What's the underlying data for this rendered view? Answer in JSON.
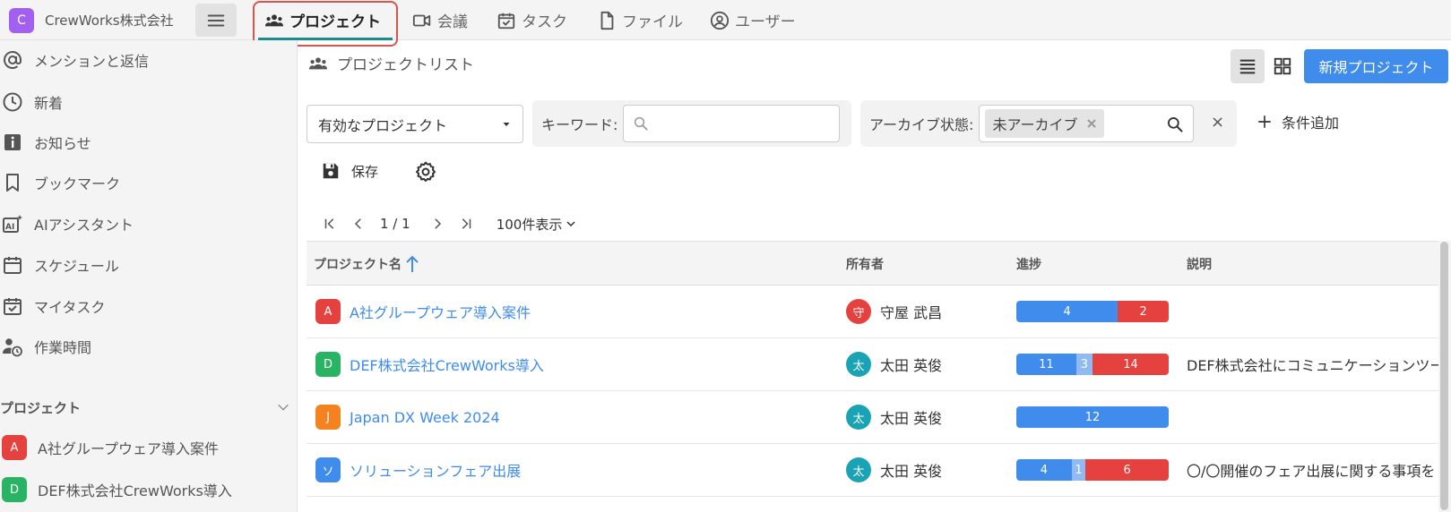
{
  "org": {
    "initial": "C",
    "name": "CrewWorks株式会社",
    "color": "#a25ff0"
  },
  "nav": {
    "tabs": [
      {
        "label": "プロジェクト",
        "icon": "people-icon",
        "active": true
      },
      {
        "label": "会議",
        "icon": "video-icon"
      },
      {
        "label": "タスク",
        "icon": "task-check-icon"
      },
      {
        "label": "ファイル",
        "icon": "file-icon"
      },
      {
        "label": "ユーザー",
        "icon": "user-circle-icon"
      }
    ]
  },
  "sidebar": {
    "items": [
      {
        "label": "メンションと返信",
        "icon": "at-icon"
      },
      {
        "label": "新着",
        "icon": "clock-icon"
      },
      {
        "label": "お知らせ",
        "icon": "info-icon"
      },
      {
        "label": "ブックマーク",
        "icon": "bookmark-icon"
      },
      {
        "label": "AIアシスタント",
        "icon": "ai-icon"
      },
      {
        "label": "スケジュール",
        "icon": "calendar-icon"
      },
      {
        "label": "マイタスク",
        "icon": "task-check-icon"
      },
      {
        "label": "作業時間",
        "icon": "user-clock-icon"
      }
    ],
    "section_title": "プロジェクト",
    "projects": [
      {
        "initial": "A",
        "label": "A社グループウェア導入案件",
        "color": "#e5413f"
      },
      {
        "initial": "D",
        "label": "DEF株式会社CrewWorks導入",
        "color": "#28b463"
      }
    ]
  },
  "main": {
    "title": "プロジェクトリスト",
    "new_button": "新規プロジェクト",
    "filter": {
      "select_value": "有効なプロジェクト",
      "keyword_label": "キーワード:",
      "keyword_value": "",
      "archive_label": "アーカイブ状態:",
      "archive_tag": "未アーカイブ",
      "clear": "×",
      "add_condition": "条件追加"
    },
    "save_label": "保存",
    "pager": {
      "page_text": "1 / 1",
      "page_size": "100件表示"
    },
    "table": {
      "headers": {
        "name": "プロジェクト名",
        "owner": "所有者",
        "progress": "進捗",
        "description": "説明"
      },
      "rows": [
        {
          "initial": "A",
          "badge_color": "#e5413f",
          "name": "A社グループウェア導入案件",
          "owner_initial": "守",
          "owner_color": "#e5413f",
          "owner": "守屋 武昌",
          "progress": [
            {
              "value": "4",
              "color": "#3f8cec"
            },
            {
              "value": "2",
              "color": "#e5413f"
            }
          ],
          "description": ""
        },
        {
          "initial": "D",
          "badge_color": "#28b463",
          "name": "DEF株式会社CrewWorks導入",
          "owner_initial": "太",
          "owner_color": "#1aa3b4",
          "owner": "太田 英俊",
          "progress": [
            {
              "value": "11",
              "color": "#3f8cec"
            },
            {
              "value": "3",
              "color": "#8fbbf2"
            },
            {
              "value": "14",
              "color": "#e5413f"
            }
          ],
          "description": "DEF株式会社にコミュニケーションツール"
        },
        {
          "initial": "J",
          "badge_color": "#f5821f",
          "name": "Japan DX Week 2024",
          "owner_initial": "太",
          "owner_color": "#1aa3b4",
          "owner": "太田 英俊",
          "progress": [
            {
              "value": "12",
              "color": "#3f8cec"
            }
          ],
          "description": ""
        },
        {
          "initial": "ソ",
          "badge_color": "#3f8cec",
          "name": "ソリューションフェア出展",
          "owner_initial": "太",
          "owner_color": "#1aa3b4",
          "owner": "太田 英俊",
          "progress": [
            {
              "value": "4",
              "color": "#3f8cec"
            },
            {
              "value": "1",
              "color": "#8fbbf2"
            },
            {
              "value": "6",
              "color": "#e5413f"
            }
          ],
          "description": "〇/〇開催のフェア出展に関する事項を"
        }
      ]
    }
  }
}
